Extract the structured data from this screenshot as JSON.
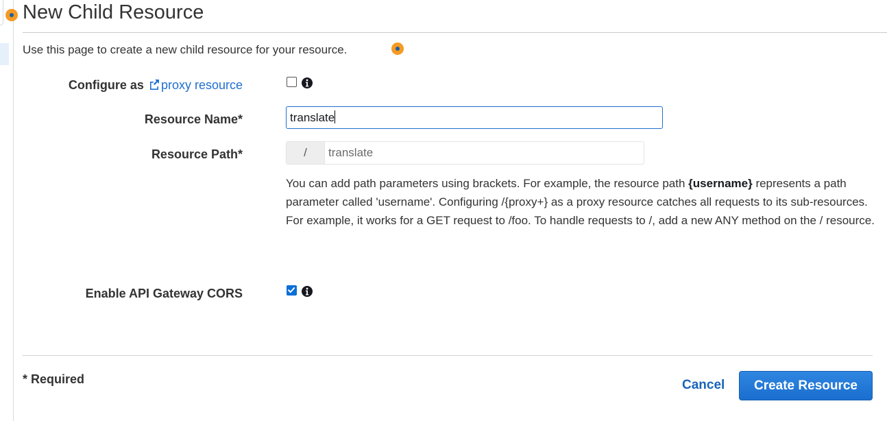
{
  "page": {
    "title": "New Child Resource",
    "intro": "Use this page to create a new child resource for your resource."
  },
  "form": {
    "configure_label": "Configure as",
    "proxy_link": "proxy resource",
    "proxy_checked": false,
    "resource_name_label": "Resource Name*",
    "resource_name_value": "translate",
    "resource_path_label": "Resource Path*",
    "resource_path_prefix": "/",
    "resource_path_value": "translate",
    "help_text_1": "You can add path parameters using brackets. For example, the resource path ",
    "help_text_bold": "{username}",
    "help_text_2": " represents a path parameter called 'username'. Configuring /{proxy+} as a proxy resource catches all requests to its sub-resources. For example, it works for a GET request to /foo. To handle requests to /, add a new ANY method on the / resource.",
    "cors_label": "Enable API Gateway CORS",
    "cors_checked": true
  },
  "footer": {
    "required_note": "* Required",
    "cancel_label": "Cancel",
    "create_label": "Create Resource"
  },
  "colors": {
    "accent": "#1f6fd1",
    "primary_button": "#1a6ecf",
    "marker": "#f59a23"
  },
  "icons": [
    "external-link-icon",
    "info-icon",
    "checkmark-icon"
  ]
}
